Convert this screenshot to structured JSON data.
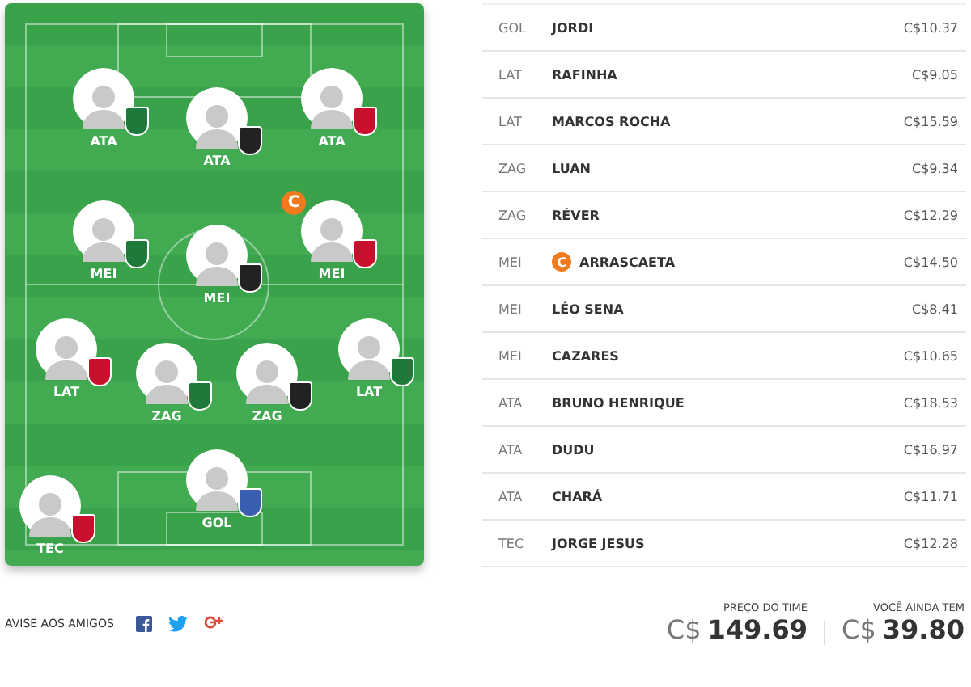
{
  "field": {
    "players": [
      {
        "position": "ATA",
        "color": "#1e7a3a",
        "captain": false
      },
      {
        "position": "ATA",
        "color": "#222222",
        "captain": false
      },
      {
        "position": "ATA",
        "color": "#c8102e",
        "captain": false
      },
      {
        "position": "MEI",
        "color": "#1e7a3a",
        "captain": false
      },
      {
        "position": "MEI",
        "color": "#222222",
        "captain": false
      },
      {
        "position": "MEI",
        "color": "#c8102e",
        "captain": true,
        "captain_mark": "C"
      },
      {
        "position": "LAT",
        "color": "#c8102e",
        "captain": false
      },
      {
        "position": "ZAG",
        "color": "#1e7a3a",
        "captain": false
      },
      {
        "position": "ZAG",
        "color": "#222222",
        "captain": false
      },
      {
        "position": "LAT",
        "color": "#1e7a3a",
        "captain": false
      },
      {
        "position": "GOL",
        "color": "#3b5fb0",
        "captain": false
      },
      {
        "position": "TEC",
        "color": "#c8102e",
        "captain": false
      }
    ]
  },
  "lineup": [
    {
      "position": "GOL",
      "name": "JORDI",
      "price": "C$10.37",
      "captain": false
    },
    {
      "position": "LAT",
      "name": "RAFINHA",
      "price": "C$9.05",
      "captain": false
    },
    {
      "position": "LAT",
      "name": "MARCOS ROCHA",
      "price": "C$15.59",
      "captain": false
    },
    {
      "position": "ZAG",
      "name": "LUAN",
      "price": "C$9.34",
      "captain": false
    },
    {
      "position": "ZAG",
      "name": "RÉVER",
      "price": "C$12.29",
      "captain": false
    },
    {
      "position": "MEI",
      "name": "ARRASCAETA",
      "price": "C$14.50",
      "captain": true,
      "captain_mark": "C"
    },
    {
      "position": "MEI",
      "name": "LÉO SENA",
      "price": "C$8.41",
      "captain": false
    },
    {
      "position": "MEI",
      "name": "CAZARES",
      "price": "C$10.65",
      "captain": false
    },
    {
      "position": "ATA",
      "name": "BRUNO HENRIQUE",
      "price": "C$18.53",
      "captain": false
    },
    {
      "position": "ATA",
      "name": "DUDU",
      "price": "C$16.97",
      "captain": false
    },
    {
      "position": "ATA",
      "name": "CHARÁ",
      "price": "C$11.71",
      "captain": false
    },
    {
      "position": "TEC",
      "name": "JORGE JESUS",
      "price": "C$12.28",
      "captain": false
    }
  ],
  "share": {
    "label": "AVISE AOS AMIGOS",
    "networks": [
      {
        "kind": "facebook"
      },
      {
        "kind": "twitter"
      },
      {
        "kind": "googleplus"
      }
    ]
  },
  "totals": [
    {
      "label": "PREÇO DO TIME",
      "currency": "C$",
      "value": "149.69"
    },
    {
      "label": "VOCÊ AINDA TEM",
      "currency": "C$",
      "value": "39.80"
    }
  ]
}
